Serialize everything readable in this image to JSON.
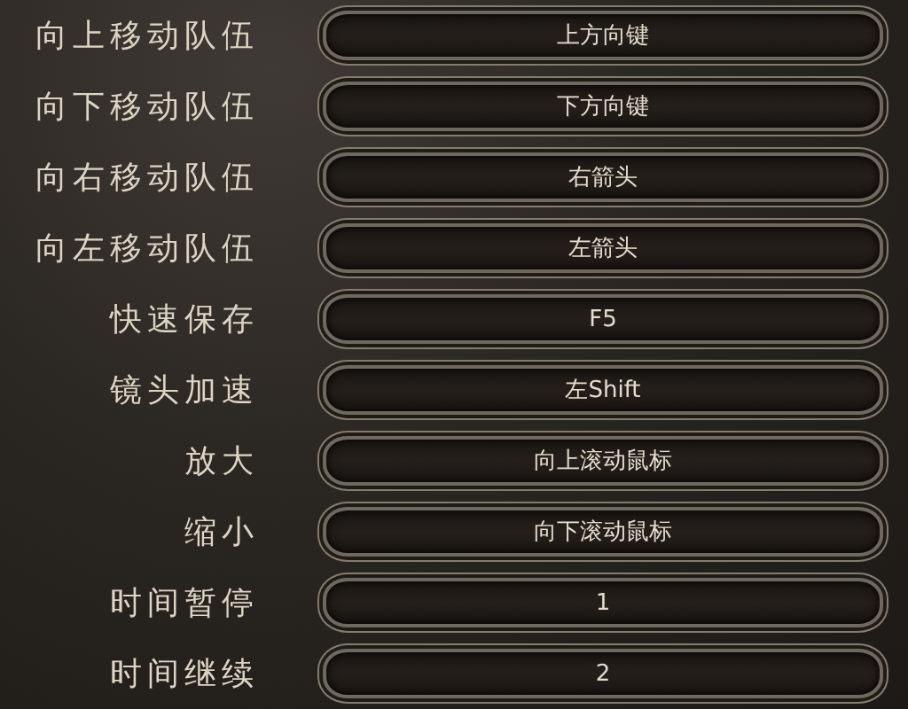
{
  "bindings": [
    {
      "action": "向上移动队伍",
      "key": "上方向键"
    },
    {
      "action": "向下移动队伍",
      "key": "下方向键"
    },
    {
      "action": "向右移动队伍",
      "key": "右箭头"
    },
    {
      "action": "向左移动队伍",
      "key": "左箭头"
    },
    {
      "action": "快速保存",
      "key": "F5"
    },
    {
      "action": "镜头加速",
      "key": "左Shift"
    },
    {
      "action": "放大",
      "key": "向上滚动鼠标"
    },
    {
      "action": "缩小",
      "key": "向下滚动鼠标"
    },
    {
      "action": "时间暂停",
      "key": "1"
    },
    {
      "action": "时间继续",
      "key": "2"
    }
  ]
}
